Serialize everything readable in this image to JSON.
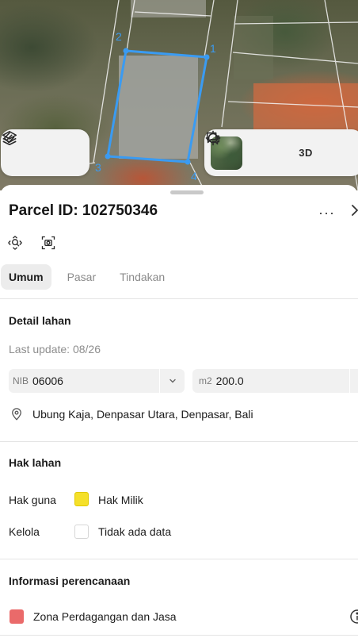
{
  "map": {
    "vertex_labels": [
      "2",
      "1",
      "3",
      "4"
    ],
    "parcel_color": "#3a9bf2",
    "layers_icon": "layers-icon",
    "measure_icon": "measure-icon",
    "basemap_thumb": "satellite-thumbnail",
    "locate_icon": "crosshair-icon",
    "mode_3d_label": "3D",
    "chat_icon": "chat-icon"
  },
  "sheet": {
    "title": "Parcel ID: 102750346",
    "more_label": "···",
    "tabs": [
      {
        "label": "Umum",
        "active": true
      },
      {
        "label": "Pasar",
        "active": false
      },
      {
        "label": "Tindakan",
        "active": false
      }
    ],
    "land_detail": {
      "heading": "Detail lahan",
      "last_update": "Last update: 08/26",
      "nib_prefix": "NIB",
      "nib_value": "06006",
      "area_prefix": "m2",
      "area_value": "200.0",
      "location": "Ubung Kaja, Denpasar Utara, Denpasar, Bali"
    },
    "land_rights": {
      "heading": "Hak lahan",
      "rows": [
        {
          "label": "Hak guna",
          "value": "Hak Milik",
          "color": "#f5e02a"
        },
        {
          "label": "Kelola",
          "value": "Tidak ada data",
          "color": "#ffffff"
        }
      ]
    },
    "planning": {
      "heading": "Informasi perencanaan",
      "zone_label": "Zona Perdagangan dan Jasa",
      "zone_color": "#ea6a6a"
    }
  }
}
